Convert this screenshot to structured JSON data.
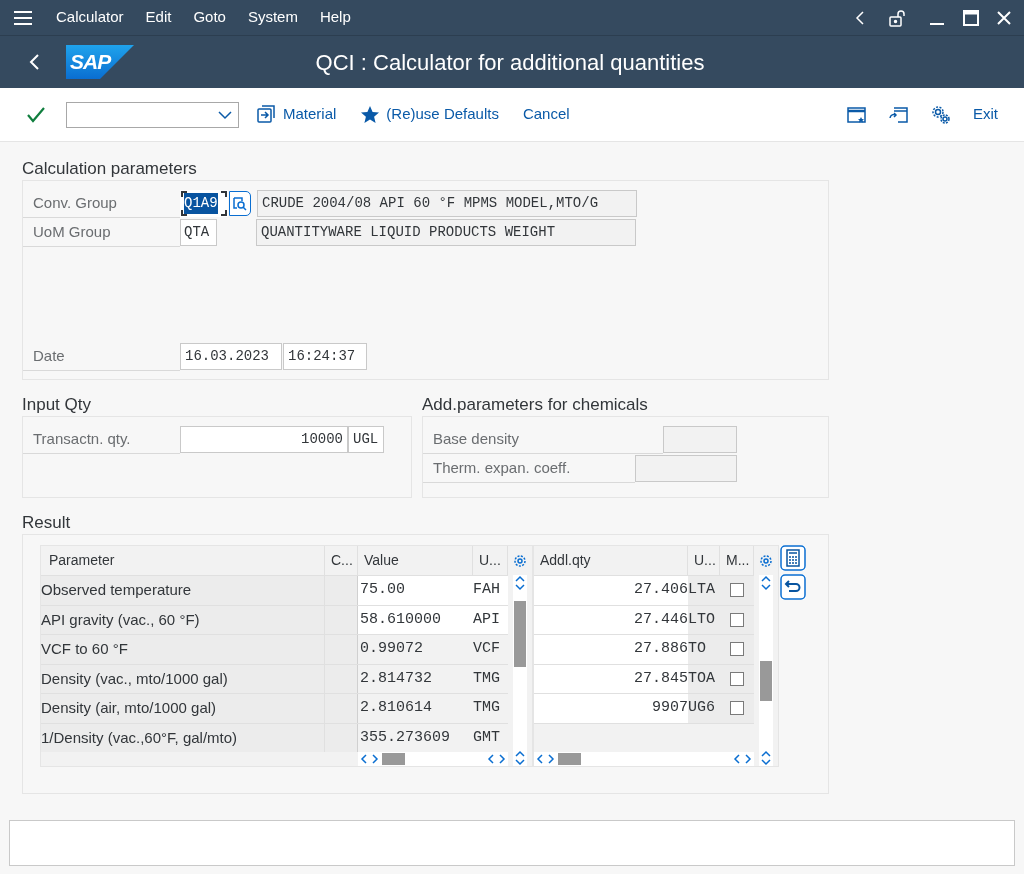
{
  "menu_bar": {
    "items": [
      "Calculator",
      "Edit",
      "Goto",
      "System",
      "Help"
    ]
  },
  "logo": "SAP",
  "title": "QCI : Calculator for additional quantities",
  "toolbar": {
    "buttons": [
      {
        "kind": "material",
        "label": "Material"
      },
      {
        "kind": "defaults",
        "label": "(Re)use Defaults"
      },
      {
        "kind": "cancel",
        "label": "Cancel"
      }
    ],
    "exit": "Exit"
  },
  "calculation_parameters": {
    "title": "Calculation parameters",
    "fields": [
      {
        "label": "Conv. Group",
        "value": "Q1A9",
        "description": "CRUDE 2004/08 API 60 °F MPMS MODEL,MTO/G",
        "focused": true
      },
      {
        "label": "UoM Group",
        "value": "QTA",
        "description": "QUANTITYWARE LIQUID PRODUCTS WEIGHT",
        "focused": false
      }
    ],
    "date": {
      "label": "Date",
      "date": "16.03.2023",
      "time": "16:24:37"
    }
  },
  "input_qty": {
    "title": "Input Qty",
    "label": "Transactn. qty.",
    "value": "10000",
    "unit": "UGL"
  },
  "chemicals": {
    "title": "Add.parameters for chemicals",
    "fields": [
      {
        "label": "Base density"
      },
      {
        "label": "Therm. expan. coeff."
      }
    ]
  },
  "result": {
    "title": "Result",
    "left_columns": [
      "Parameter",
      "C...",
      "Value",
      "U..."
    ],
    "rows": [
      {
        "parameter": "Observed temperature",
        "value": "75.00",
        "unit": "FAH",
        "editable": true
      },
      {
        "parameter": "API gravity (vac., 60 °F)",
        "value": "58.610000",
        "unit": "API",
        "editable": true
      },
      {
        "parameter": "VCF to 60 °F",
        "value": "0.99072",
        "unit": "VCF",
        "editable": false
      },
      {
        "parameter": "Density (vac., mto/1000 gal)",
        "value": "2.814732",
        "unit": "TMG",
        "editable": false
      },
      {
        "parameter": "Density (air, mto/1000 gal)",
        "value": "2.810614",
        "unit": "TMG",
        "editable": false
      },
      {
        "parameter": "1/Density (vac.,60°F, gal/mto)",
        "value": "355.273609",
        "unit": "GMT",
        "editable": false
      }
    ],
    "right_columns": [
      "Addl.qty",
      "U...",
      "M..."
    ],
    "right_rows": [
      {
        "qty": "27.406",
        "unit": "LTA",
        "checked": false
      },
      {
        "qty": "27.446",
        "unit": "LTO",
        "checked": false
      },
      {
        "qty": "27.886",
        "unit": "TO",
        "checked": false
      },
      {
        "qty": "27.845",
        "unit": "TOA",
        "checked": false
      },
      {
        "qty": "9907",
        "unit": "UG6",
        "checked": false
      }
    ]
  }
}
